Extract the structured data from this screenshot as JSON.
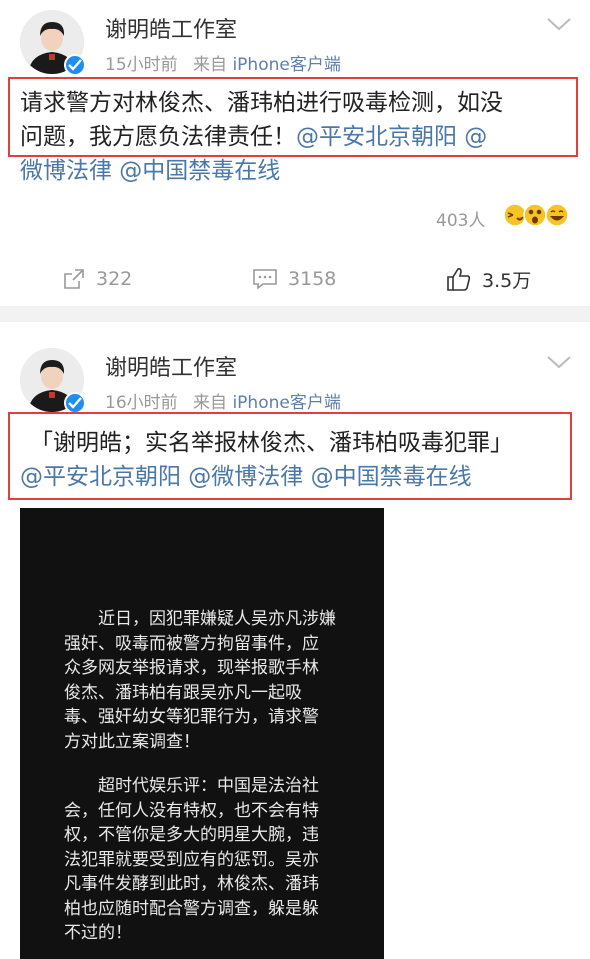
{
  "posts": [
    {
      "author": "谢明皓工作室",
      "time": "15小时前",
      "source_prefix": "来自",
      "source": "iPhone客户端",
      "text_line1": "请求警方对林俊杰、潘玮柏进行吸毒检测，如没",
      "text_line2_plain": "问题，我方愿负法律责任！",
      "text_line2_mention": "@平安北京朝阳 @",
      "text_line3_mention": "微博法律 @中国禁毒在线",
      "reaction_count": "403人",
      "repost_count": "322",
      "comment_count": "3158",
      "like_count": "3.5万"
    },
    {
      "author": "谢明皓工作室",
      "time": "16小时前",
      "source_prefix": "来自",
      "source": "iPhone客户端",
      "text_line1": "「谢明皓；实名举报林俊杰、潘玮柏吸毒犯罪」",
      "text_line2_mention": "@平安北京朝阳 @微博法律 @中国禁毒在线",
      "image_paragraph1": [
        "近日，因犯罪嫌疑人吴亦凡涉嫌",
        "强奸、吸毒而被警方拘留事件，应",
        "众多网友举报请求，现举报歌手林",
        "俊杰、潘玮柏有跟吴亦凡一起吸",
        "毒、强奸幼女等犯罪行为，请求警",
        "方对此立案调查！"
      ],
      "image_paragraph2": [
        "超时代娱乐评：中国是法治社",
        "会，任何人没有特权，也不会有特",
        "权，不管你是多大的明星大腕，违",
        "法犯罪就要受到应有的惩罚。吴亦",
        "凡事件发酵到此时，林俊杰、潘玮",
        "柏也应随时配合警方调查，躲是躲",
        "不过的！"
      ]
    }
  ],
  "colors": {
    "mention": "#4a78a8",
    "highlight_box": "#e33e3e",
    "verified_badge": "#1d8ff0",
    "meta_text": "#999999"
  },
  "icons": {
    "repost": "repost-icon",
    "comment": "comment-icon",
    "like": "thumbs-up-icon",
    "more": "chevron-down-icon",
    "verified": "verified-badge-icon"
  }
}
